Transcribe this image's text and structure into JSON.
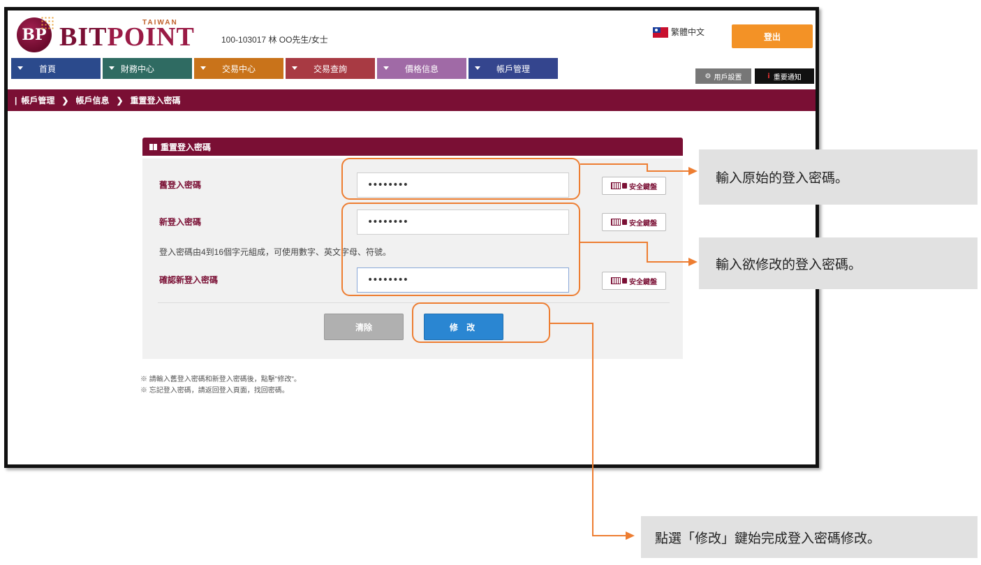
{
  "header": {
    "logo_mark": "BP",
    "logo_bit": "BIT",
    "logo_point": "POINT",
    "logo_region": "TAIWAN",
    "account": "100-103017  林  OO先生/女士",
    "language": "繁體中文",
    "logout": "登出"
  },
  "nav": {
    "items": [
      {
        "label": "首頁",
        "color": "#2b4a8c"
      },
      {
        "label": "財務中心",
        "color": "#2f6b62"
      },
      {
        "label": "交易中心",
        "color": "#c9731a"
      },
      {
        "label": "交易查詢",
        "color": "#a83a43"
      },
      {
        "label": "價格信息",
        "color": "#a06aa6"
      },
      {
        "label": "帳戶管理",
        "color": "#34458e"
      }
    ],
    "user_settings": "用戶設置",
    "notice": "重要通知"
  },
  "breadcrumb": [
    "帳戶管理",
    "帳戶信息",
    "重置登入密碼"
  ],
  "form": {
    "title": "重置登入密碼",
    "old_label": "舊登入密碼",
    "old_value": "••••••••",
    "new_label": "新登入密碼",
    "new_value": "••••••••",
    "hint": "登入密碼由4到16個字元組成，可使用數字、英文字母、符號。",
    "confirm_label": "確認新登入密碼",
    "confirm_value": "••••••••",
    "secure_keyboard": "安全鍵盤",
    "clear": "清除",
    "modify": "修 改"
  },
  "notes": [
    "※  請輸入舊登入密碼和新登入密碼後，點擊\"修改\"。",
    "※  忘記登入密碼，請返回登入頁面，找回密碼。"
  ],
  "callouts": {
    "old": "輸入原始的登入密碼。",
    "new": "輸入欲修改的登入密碼。",
    "modify": "點選「修改」鍵始完成登入密碼修改。"
  },
  "colors": {
    "brand": "#7a0f34",
    "accent": "#ed7d31",
    "logout": "#f39226",
    "primary_button": "#2a86d2"
  }
}
